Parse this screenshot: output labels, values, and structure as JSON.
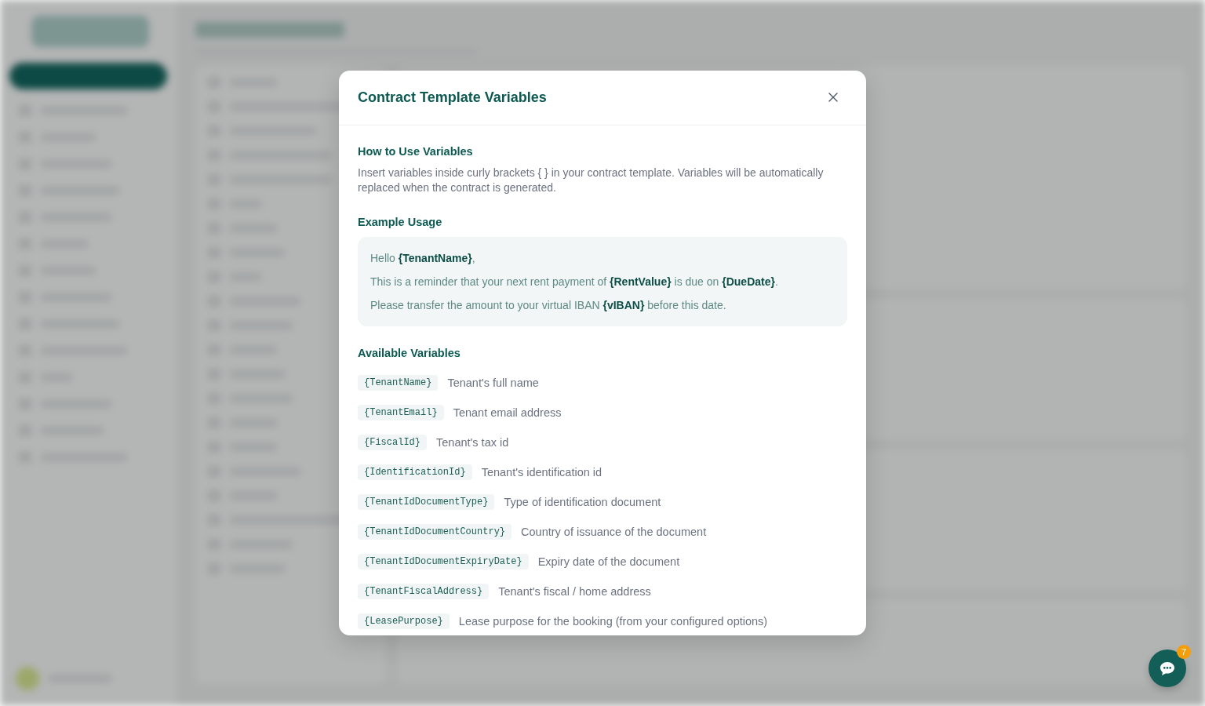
{
  "modal": {
    "title": "Contract Template Variables",
    "how_to": {
      "heading": "How to Use Variables",
      "text": "Insert variables inside curly brackets { } in your contract template. Variables will be automatically replaced when the contract is generated."
    },
    "example": {
      "heading": "Example Usage",
      "lines": [
        "Hello **{TenantName}**,",
        "This is a reminder that your next rent payment of **{RentValue}** is due on **{DueDate}**.",
        "Please transfer the amount to your virtual IBAN **{vIBAN}** before this date."
      ]
    },
    "variables": {
      "heading": "Available Variables",
      "items": [
        {
          "code": "{TenantName}",
          "description": "Tenant's full name"
        },
        {
          "code": "{TenantEmail}",
          "description": "Tenant email address"
        },
        {
          "code": "{FiscalId}",
          "description": "Tenant's tax id"
        },
        {
          "code": "{IdentificationId}",
          "description": "Tenant's identification id"
        },
        {
          "code": "{TenantIdDocumentType}",
          "description": "Type of identification document"
        },
        {
          "code": "{TenantIdDocumentCountry}",
          "description": "Country of issuance of the document"
        },
        {
          "code": "{TenantIdDocumentExpiryDate}",
          "description": "Expiry date of the document"
        },
        {
          "code": "{TenantFiscalAddress}",
          "description": "Tenant's fiscal / home address"
        },
        {
          "code": "{LeasePurpose}",
          "description": "Lease purpose for the booking (from your configured options)"
        }
      ]
    }
  },
  "chat_button": {
    "badge": "7"
  }
}
